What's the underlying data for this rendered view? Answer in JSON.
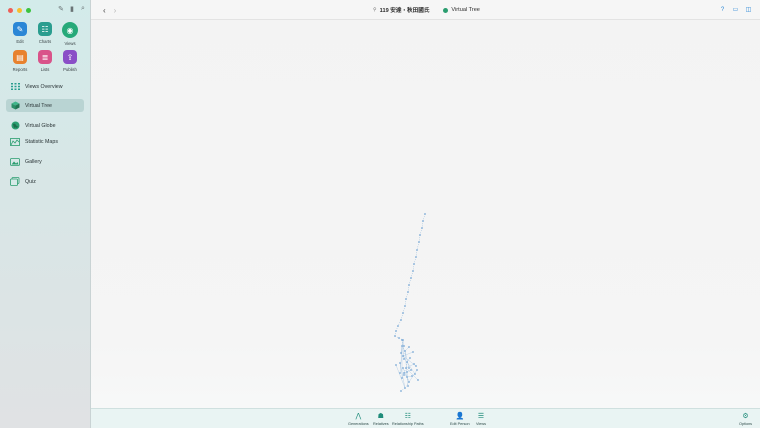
{
  "window": {
    "breadcrumb_person": "119 安達・秋田國氏",
    "breadcrumb_view": "Virtual Tree"
  },
  "sidebar": {
    "tiles": [
      {
        "label": "Edit",
        "icon": "pencil-icon",
        "color": "#2b87d6"
      },
      {
        "label": "Charts",
        "icon": "charts-icon",
        "color": "#2a9d8f"
      },
      {
        "label": "Views",
        "icon": "eye-icon",
        "color": "#26a979"
      },
      {
        "label": "Reports",
        "icon": "reports-icon",
        "color": "#e8822e"
      },
      {
        "label": "Lists",
        "icon": "lists-icon",
        "color": "#d9538a"
      },
      {
        "label": "Publish",
        "icon": "publish-icon",
        "color": "#8a4fc7"
      }
    ],
    "items": [
      {
        "label": "Views Overview",
        "icon": "grid-icon"
      },
      {
        "label": "Virtual Tree",
        "icon": "cube-icon",
        "active": true
      },
      {
        "label": "Virtual Globe",
        "icon": "globe-icon"
      },
      {
        "label": "Statistic Maps",
        "icon": "map-icon"
      },
      {
        "label": "Gallery",
        "icon": "gallery-icon"
      },
      {
        "label": "Quiz",
        "icon": "quiz-icon"
      }
    ]
  },
  "bottombar": {
    "buttons": [
      {
        "label": "Generations",
        "icon": "generations-icon"
      },
      {
        "label": "Relatives",
        "icon": "relatives-icon"
      },
      {
        "label": "Relationship Paths",
        "icon": "paths-icon"
      },
      {
        "label": "Edit Person",
        "icon": "person-icon"
      },
      {
        "label": "Views",
        "icon": "views-icon"
      },
      {
        "label": "Options",
        "icon": "options-icon"
      }
    ]
  },
  "colors": {
    "accent": "#2a9d6f",
    "tree_node": "#7aa9d6",
    "sidebar_bg": "#d3ebea",
    "bottombar_bg": "#e9f4f3"
  }
}
